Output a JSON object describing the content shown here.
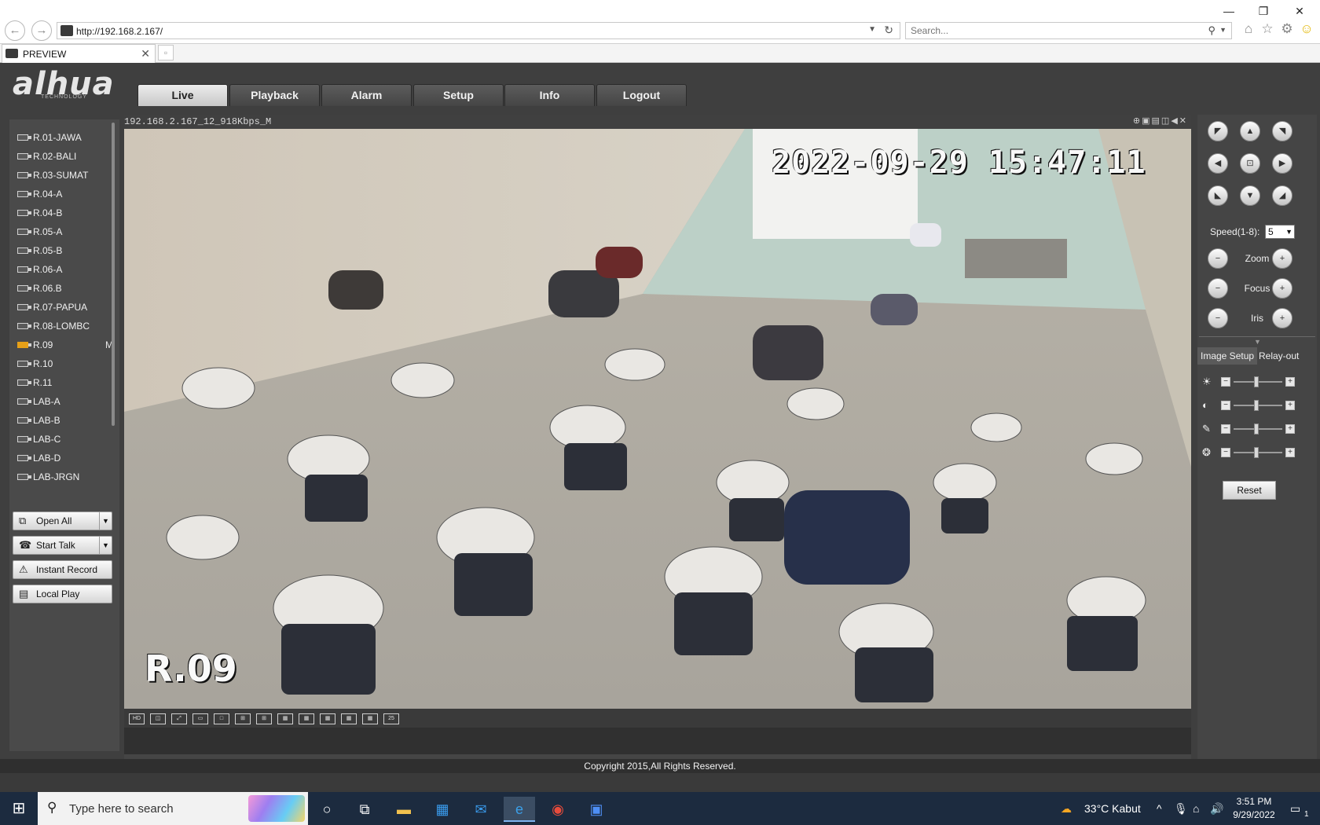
{
  "browser": {
    "url": "http://192.168.2.167/",
    "search_placeholder": "Search...",
    "tab_label": "PREVIEW"
  },
  "app": {
    "logo": "alhua",
    "logo_sub": "TECHNOLOGY",
    "menu": [
      "Live",
      "Playback",
      "Alarm",
      "Setup",
      "Info",
      "Logout"
    ],
    "channels": [
      {
        "label": "R.01-JAWA",
        "mark": ""
      },
      {
        "label": "R.02-BALI",
        "mark": ""
      },
      {
        "label": "R.03-SUMAT",
        "mark": ""
      },
      {
        "label": "R.04-A",
        "mark": ""
      },
      {
        "label": "R.04-B",
        "mark": ""
      },
      {
        "label": "R.05-A",
        "mark": ""
      },
      {
        "label": "R.05-B",
        "mark": ""
      },
      {
        "label": "R.06-A",
        "mark": ""
      },
      {
        "label": "R.06.B",
        "mark": ""
      },
      {
        "label": "R.07-PAPUA",
        "mark": ""
      },
      {
        "label": "R.08-LOMBC",
        "mark": ""
      },
      {
        "label": "R.09",
        "mark": "M"
      },
      {
        "label": "R.10",
        "mark": ""
      },
      {
        "label": "R.11",
        "mark": ""
      },
      {
        "label": "LAB-A",
        "mark": ""
      },
      {
        "label": "LAB-B",
        "mark": ""
      },
      {
        "label": "LAB-C",
        "mark": ""
      },
      {
        "label": "LAB-D",
        "mark": ""
      },
      {
        "label": "LAB-JRGN",
        "mark": ""
      }
    ],
    "actions": {
      "open_all": "Open All",
      "start_talk": "Start Talk",
      "instant_record": "Instant Record",
      "local_play": "Local Play"
    },
    "video": {
      "stream_title": "192.168.2.167_12_918Kbps_M",
      "timestamp": "2022-09-29 15:47:11",
      "camera_label": "R.09"
    },
    "ptz": {
      "speed_label": "Speed(1-8):",
      "speed_value": "5",
      "zoom": "Zoom",
      "focus": "Focus",
      "iris": "Iris",
      "image_setup": "Image Setup",
      "relay_out": "Relay-out",
      "reset": "Reset"
    },
    "copyright": "Copyright 2015,All Rights Reserved."
  },
  "taskbar": {
    "search_text": "Type here to search",
    "weather": "33°C  Kabut",
    "time": "3:51 PM",
    "date": "9/29/2022",
    "notification_count": "1"
  }
}
